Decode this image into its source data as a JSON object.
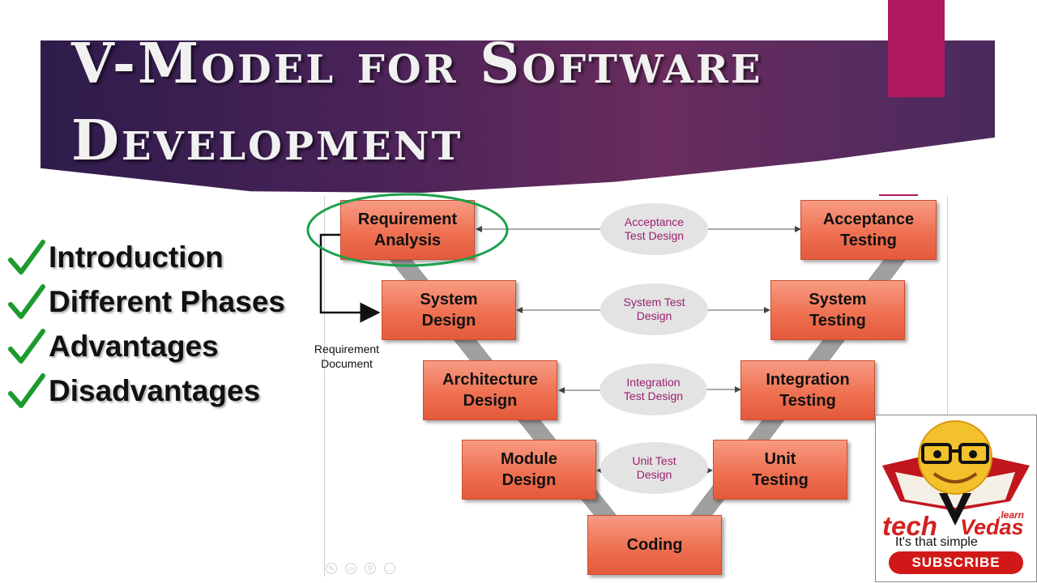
{
  "title": {
    "line1": "V-Model for Software",
    "line2": "Development"
  },
  "topics": [
    {
      "label": "Introduction"
    },
    {
      "label": "Different Phases"
    },
    {
      "label": "Advantages"
    },
    {
      "label": "Disadvantages"
    }
  ],
  "diagram": {
    "verification_phases": [
      {
        "label": "Requirement\nAnalysis"
      },
      {
        "label": "System\nDesign"
      },
      {
        "label": "Architecture\nDesign"
      },
      {
        "label": "Module\nDesign"
      }
    ],
    "validation_phases": [
      {
        "label": "Acceptance\nTesting"
      },
      {
        "label": "System\nTesting"
      },
      {
        "label": "Integration\nTesting"
      },
      {
        "label": "Unit\nTesting"
      }
    ],
    "coding": {
      "label": "Coding"
    },
    "test_designs": [
      {
        "label": "Acceptance\nTest Design"
      },
      {
        "label": "System Test\nDesign"
      },
      {
        "label": "Integration\nTest Design"
      },
      {
        "label": "Unit Test\nDesign"
      }
    ],
    "side_label": "Requirement\nDocument"
  },
  "logo": {
    "brand_prefix": "tech",
    "brand_suffix": "Vedas",
    "brand_sup": ".learn",
    "tagline": "It's that simple",
    "subscribe": "SUBSCRIBE"
  },
  "colors": {
    "banner": "#4a2358",
    "accent_bar": "#b0195e",
    "phase_box": "#ef7152",
    "design_text": "#9b2070",
    "highlight": "#1aa04a",
    "check": "#1e9a2f"
  }
}
